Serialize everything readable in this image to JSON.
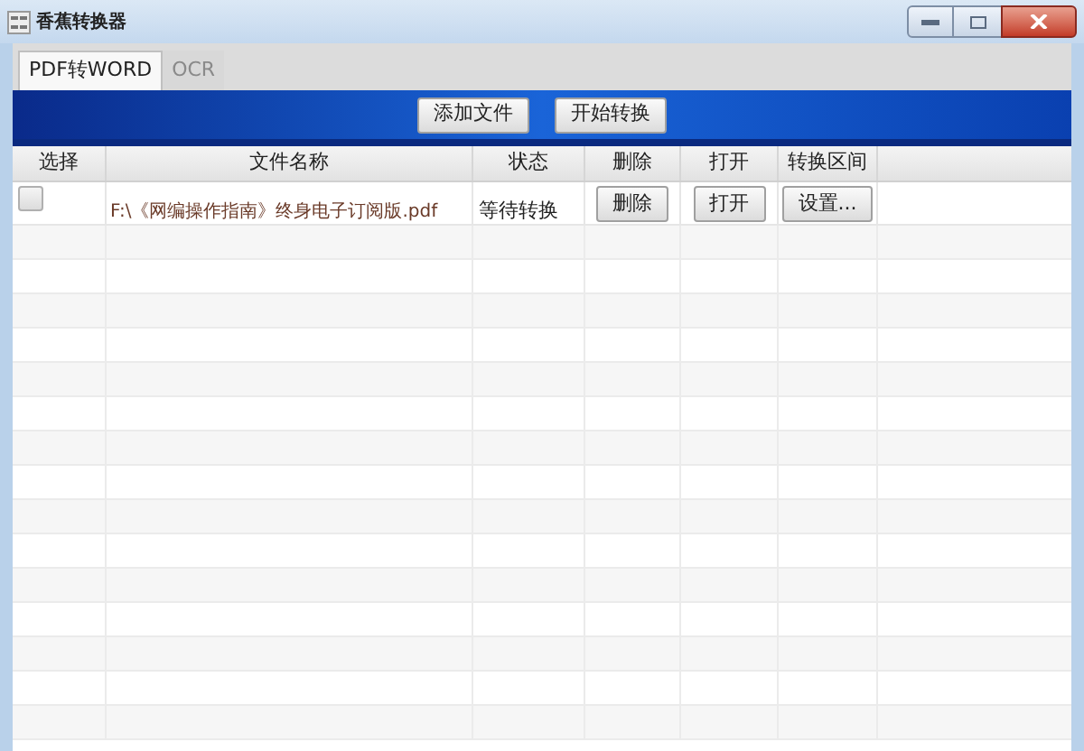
{
  "window": {
    "title": "香蕉转换器"
  },
  "tabs": [
    {
      "label": "PDF转WORD",
      "selected": true
    },
    {
      "label": "OCR",
      "selected": false
    }
  ],
  "toolbar": {
    "buttons": [
      "添加文件",
      "开始转换"
    ]
  },
  "table": {
    "columns": [
      "选择",
      "文件名称",
      "状态",
      "删除",
      "打开",
      "转换区间"
    ],
    "rows": [
      {
        "checked": false,
        "file": "F:\\《网编操作指南》终身电子订阅版.pdf",
        "status": "等待转换",
        "delete": "删除",
        "open": "打开",
        "range": "设置..."
      }
    ]
  }
}
